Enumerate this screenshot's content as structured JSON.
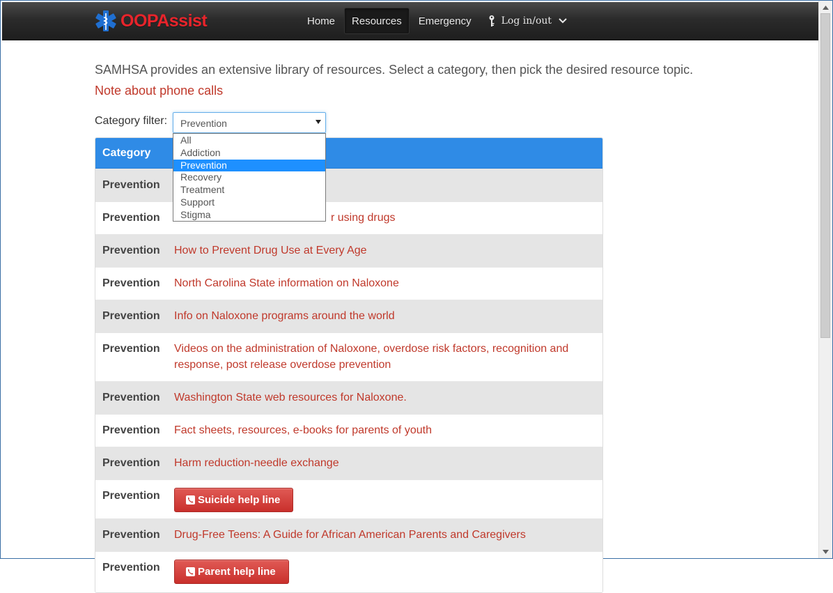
{
  "brand": {
    "name": "OOPAssist"
  },
  "nav": {
    "items": [
      {
        "label": "Home"
      },
      {
        "label": "Resources",
        "active": true
      },
      {
        "label": "Emergency"
      }
    ],
    "login_label": "Log in/out"
  },
  "intro": {
    "text": "SAMHSA provides an extensive library of resources. Select a category, then pick the desired resource topic.",
    "link": "Note about phone calls"
  },
  "filter": {
    "label": "Category filter:",
    "selected": "Prevention",
    "options": [
      "All",
      "Addiction",
      "Prevention",
      "Recovery",
      "Treatment",
      "Support",
      "Stigma"
    ]
  },
  "table": {
    "header": "Category",
    "rows": [
      {
        "category": "Prevention",
        "resource": ""
      },
      {
        "category": "Prevention",
        "resource": "r using drugs"
      },
      {
        "category": "Prevention",
        "resource": "How to Prevent Drug Use at Every Age"
      },
      {
        "category": "Prevention",
        "resource": "North Carolina State information on Naloxone"
      },
      {
        "category": "Prevention",
        "resource": "Info on Naloxone programs around the world"
      },
      {
        "category": "Prevention",
        "resource": "Videos on the administration of Naloxone, overdose risk factors, recognition and response, post release overdose prevention"
      },
      {
        "category": "Prevention",
        "resource": "Washington State web resources for Naloxone."
      },
      {
        "category": "Prevention",
        "resource": "Fact sheets, resources, e-books for parents of youth"
      },
      {
        "category": "Prevention",
        "resource": "Harm reduction-needle exchange"
      },
      {
        "category": "Prevention",
        "button": "Suicide help line"
      },
      {
        "category": "Prevention",
        "resource": "Drug-Free Teens: A Guide for African American Parents and Caregivers"
      },
      {
        "category": "Prevention",
        "button": "Parent help line"
      }
    ]
  },
  "colors": {
    "brand_red": "#e8242b",
    "link_red": "#c0392b",
    "table_header_blue": "#2f8be6",
    "button_red": "#d9534f"
  }
}
